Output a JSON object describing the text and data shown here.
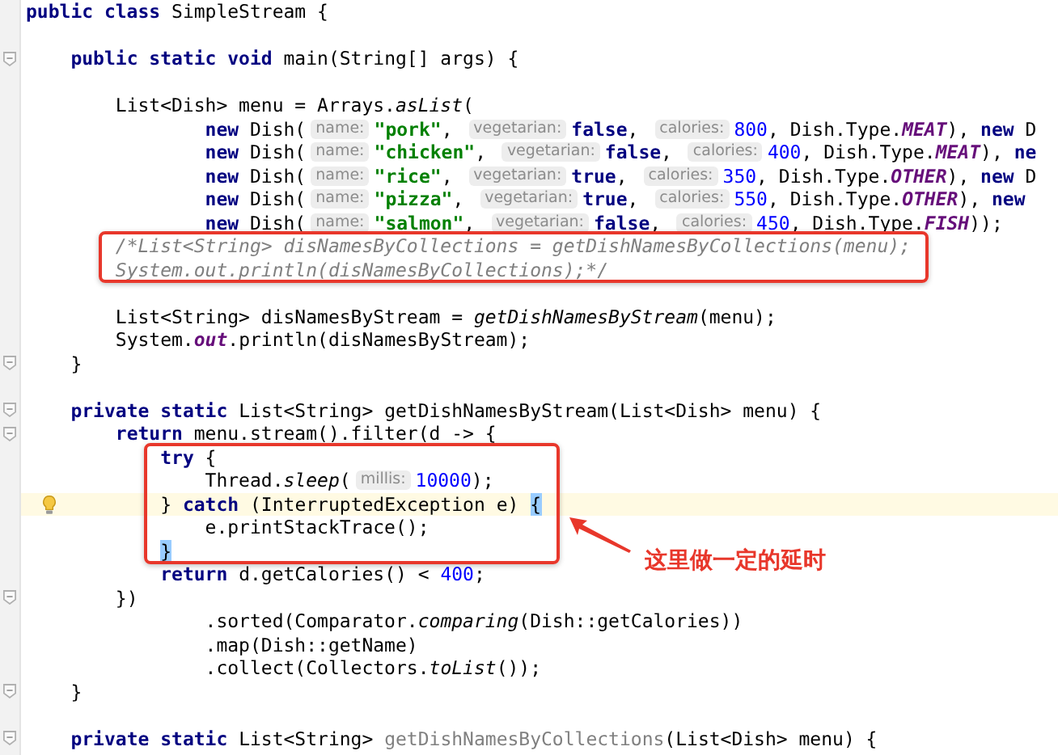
{
  "editor": {
    "lines": [
      {
        "tokens": [
          {
            "kind": "kw",
            "text": "public class"
          },
          {
            "kind": "plain",
            "text": " SimpleStream {"
          }
        ]
      },
      {
        "blank_before": true,
        "fold_marker": true,
        "tokens": [
          {
            "kind": "kw",
            "text": "    public static void"
          },
          {
            "kind": "plain",
            "text": " main(String[] args) {"
          }
        ]
      },
      {
        "blank_before": true,
        "tokens": [
          {
            "kind": "plain",
            "text": "        List<Dish> menu = Arrays."
          },
          {
            "kind": "italic",
            "text": "asList"
          },
          {
            "kind": "plain",
            "text": "("
          }
        ]
      },
      {
        "tokens": [
          {
            "kind": "kw",
            "text": "                new"
          },
          {
            "kind": "plain",
            "text": " Dish("
          },
          {
            "kind": "hint",
            "text": "name:"
          },
          {
            "kind": "str",
            "text": "\"pork\""
          },
          {
            "kind": "plain",
            "text": ", "
          },
          {
            "kind": "hint",
            "text": "vegetarian:"
          },
          {
            "kind": "kw",
            "text": "false"
          },
          {
            "kind": "plain",
            "text": ", "
          },
          {
            "kind": "hint",
            "text": "calories:"
          },
          {
            "kind": "num",
            "text": "800"
          },
          {
            "kind": "plain",
            "text": ", Dish.Type."
          },
          {
            "kind": "const",
            "text": "MEAT"
          },
          {
            "kind": "plain",
            "text": "), "
          },
          {
            "kind": "kw",
            "text": "new"
          },
          {
            "kind": "plain",
            "text": " D"
          }
        ]
      },
      {
        "tokens": [
          {
            "kind": "kw",
            "text": "                new"
          },
          {
            "kind": "plain",
            "text": " Dish("
          },
          {
            "kind": "hint",
            "text": "name:"
          },
          {
            "kind": "str",
            "text": "\"chicken\""
          },
          {
            "kind": "plain",
            "text": ", "
          },
          {
            "kind": "hint",
            "text": "vegetarian:"
          },
          {
            "kind": "kw",
            "text": "false"
          },
          {
            "kind": "plain",
            "text": ", "
          },
          {
            "kind": "hint",
            "text": "calories:"
          },
          {
            "kind": "num",
            "text": "400"
          },
          {
            "kind": "plain",
            "text": ", Dish.Type."
          },
          {
            "kind": "const",
            "text": "MEAT"
          },
          {
            "kind": "plain",
            "text": "), "
          },
          {
            "kind": "kw",
            "text": "ne"
          }
        ]
      },
      {
        "tokens": [
          {
            "kind": "kw",
            "text": "                new"
          },
          {
            "kind": "plain",
            "text": " Dish("
          },
          {
            "kind": "hint",
            "text": "name:"
          },
          {
            "kind": "str",
            "text": "\"rice\""
          },
          {
            "kind": "plain",
            "text": ", "
          },
          {
            "kind": "hint",
            "text": "vegetarian:"
          },
          {
            "kind": "kw",
            "text": "true"
          },
          {
            "kind": "plain",
            "text": ", "
          },
          {
            "kind": "hint",
            "text": "calories:"
          },
          {
            "kind": "num",
            "text": "350"
          },
          {
            "kind": "plain",
            "text": ", Dish.Type."
          },
          {
            "kind": "const",
            "text": "OTHER"
          },
          {
            "kind": "plain",
            "text": "), "
          },
          {
            "kind": "kw",
            "text": "new"
          },
          {
            "kind": "plain",
            "text": " D"
          }
        ]
      },
      {
        "tokens": [
          {
            "kind": "kw",
            "text": "                new"
          },
          {
            "kind": "plain",
            "text": " Dish("
          },
          {
            "kind": "hint",
            "text": "name:"
          },
          {
            "kind": "str",
            "text": "\"pizza\""
          },
          {
            "kind": "plain",
            "text": ", "
          },
          {
            "kind": "hint",
            "text": "vegetarian:"
          },
          {
            "kind": "kw",
            "text": "true"
          },
          {
            "kind": "plain",
            "text": ", "
          },
          {
            "kind": "hint",
            "text": "calories:"
          },
          {
            "kind": "num",
            "text": "550"
          },
          {
            "kind": "plain",
            "text": ", Dish.Type."
          },
          {
            "kind": "const",
            "text": "OTHER"
          },
          {
            "kind": "plain",
            "text": "), "
          },
          {
            "kind": "kw",
            "text": "new"
          }
        ]
      },
      {
        "tokens": [
          {
            "kind": "kw",
            "text": "                new"
          },
          {
            "kind": "plain",
            "text": " Dish("
          },
          {
            "kind": "hint",
            "text": "name:"
          },
          {
            "kind": "str",
            "text": "\"salmon\""
          },
          {
            "kind": "plain",
            "text": ", "
          },
          {
            "kind": "hint",
            "text": "vegetarian:"
          },
          {
            "kind": "kw",
            "text": "false"
          },
          {
            "kind": "plain",
            "text": ", "
          },
          {
            "kind": "hint",
            "text": "calories:"
          },
          {
            "kind": "num",
            "text": "450"
          },
          {
            "kind": "plain",
            "text": ", Dish.Type."
          },
          {
            "kind": "const",
            "text": "FISH"
          },
          {
            "kind": "plain",
            "text": "));"
          }
        ]
      },
      {
        "boxed": true,
        "tokens": [
          {
            "kind": "comment",
            "text": "        /*List<String> disNamesByCollections = getDishNamesByCollections(menu);"
          }
        ]
      },
      {
        "boxed": true,
        "tokens": [
          {
            "kind": "comment",
            "text": "        System.out.println(disNamesByCollections);*/"
          }
        ]
      },
      {
        "blank_before": true,
        "tokens": [
          {
            "kind": "plain",
            "text": "        List<String> disNamesByStream = "
          },
          {
            "kind": "italic",
            "text": "getDishNamesByStream"
          },
          {
            "kind": "plain",
            "text": "(menu);"
          }
        ]
      },
      {
        "tokens": [
          {
            "kind": "plain",
            "text": "        System."
          },
          {
            "kind": "const",
            "text": "out"
          },
          {
            "kind": "plain",
            "text": ".println(disNamesByStream);"
          }
        ]
      },
      {
        "fold_marker": true,
        "tokens": [
          {
            "kind": "plain",
            "text": "    }"
          }
        ]
      },
      {
        "blank_before": true,
        "fold_marker": true,
        "tokens": [
          {
            "kind": "kw",
            "text": "    private static"
          },
          {
            "kind": "plain",
            "text": " List<String> getDishNamesByStream(List<Dish> menu) {"
          }
        ]
      },
      {
        "fold_marker": true,
        "tokens": [
          {
            "kind": "kw",
            "text": "        return"
          },
          {
            "kind": "plain",
            "text": " menu.stream().filter(d -> {"
          }
        ]
      },
      {
        "boxed": true,
        "tokens": [
          {
            "kind": "kw",
            "text": "            try"
          },
          {
            "kind": "plain",
            "text": " {"
          }
        ]
      },
      {
        "boxed": true,
        "tokens": [
          {
            "kind": "plain",
            "text": "                Thread."
          },
          {
            "kind": "italic",
            "text": "sleep"
          },
          {
            "kind": "plain",
            "text": "("
          },
          {
            "kind": "hint",
            "text": "millis:"
          },
          {
            "kind": "num",
            "text": "10000"
          },
          {
            "kind": "plain",
            "text": ");"
          }
        ]
      },
      {
        "boxed": true,
        "current": true,
        "bulb": true,
        "tokens": [
          {
            "kind": "plain",
            "text": "            } "
          },
          {
            "kind": "kw",
            "text": "catch"
          },
          {
            "kind": "plain",
            "text": " (InterruptedException e) "
          },
          {
            "kind": "match",
            "text": "{"
          }
        ]
      },
      {
        "boxed": true,
        "tokens": [
          {
            "kind": "plain",
            "text": "                e.printStackTrace();"
          }
        ]
      },
      {
        "boxed": true,
        "tokens": [
          {
            "kind": "match",
            "text": "            }"
          }
        ]
      },
      {
        "tokens": [
          {
            "kind": "kw",
            "text": "            return"
          },
          {
            "kind": "plain",
            "text": " d.getCalories() < "
          },
          {
            "kind": "num",
            "text": "400"
          },
          {
            "kind": "plain",
            "text": ";"
          }
        ]
      },
      {
        "fold_marker": true,
        "tokens": [
          {
            "kind": "plain",
            "text": "        })"
          }
        ]
      },
      {
        "tokens": [
          {
            "kind": "plain",
            "text": "                .sorted(Comparator."
          },
          {
            "kind": "italic",
            "text": "comparing"
          },
          {
            "kind": "plain",
            "text": "(Dish::getCalories))"
          }
        ]
      },
      {
        "tokens": [
          {
            "kind": "plain",
            "text": "                .map(Dish::getName)"
          }
        ]
      },
      {
        "tokens": [
          {
            "kind": "plain",
            "text": "                .collect(Collectors."
          },
          {
            "kind": "italic",
            "text": "toList"
          },
          {
            "kind": "plain",
            "text": "());"
          }
        ]
      },
      {
        "fold_marker": true,
        "tokens": [
          {
            "kind": "plain",
            "text": "    }"
          }
        ]
      },
      {
        "blank_before": true,
        "fold_marker": true,
        "tokens": [
          {
            "kind": "kw",
            "text": "    private static"
          },
          {
            "kind": "plain",
            "text": " List<String> "
          },
          {
            "kind": "unused",
            "text": "getDishNamesByCollections"
          },
          {
            "kind": "plain",
            "text": "(List<Dish> menu) {"
          }
        ]
      }
    ]
  },
  "callout": {
    "text": "这里做一定的延时"
  }
}
